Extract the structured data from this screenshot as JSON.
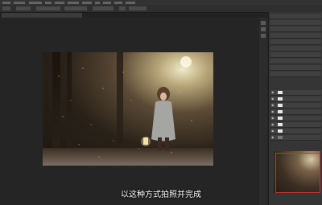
{
  "caption": "以这种方式拍照并完成",
  "window": {
    "document_tab_label": ""
  },
  "menubar": {
    "items": [
      "",
      "",
      "",
      "",
      "",
      "",
      "",
      "",
      "",
      "",
      ""
    ]
  },
  "layers_panel": {
    "layers": [
      "",
      "",
      "",
      "",
      "",
      "",
      "",
      ""
    ]
  },
  "history_panel": {
    "items": [
      "",
      "",
      "",
      "",
      "",
      "",
      "",
      "",
      "",
      ""
    ]
  },
  "colors": {
    "accent": "#c0352b",
    "ui_dark": "#262626",
    "panel": "#353535"
  }
}
